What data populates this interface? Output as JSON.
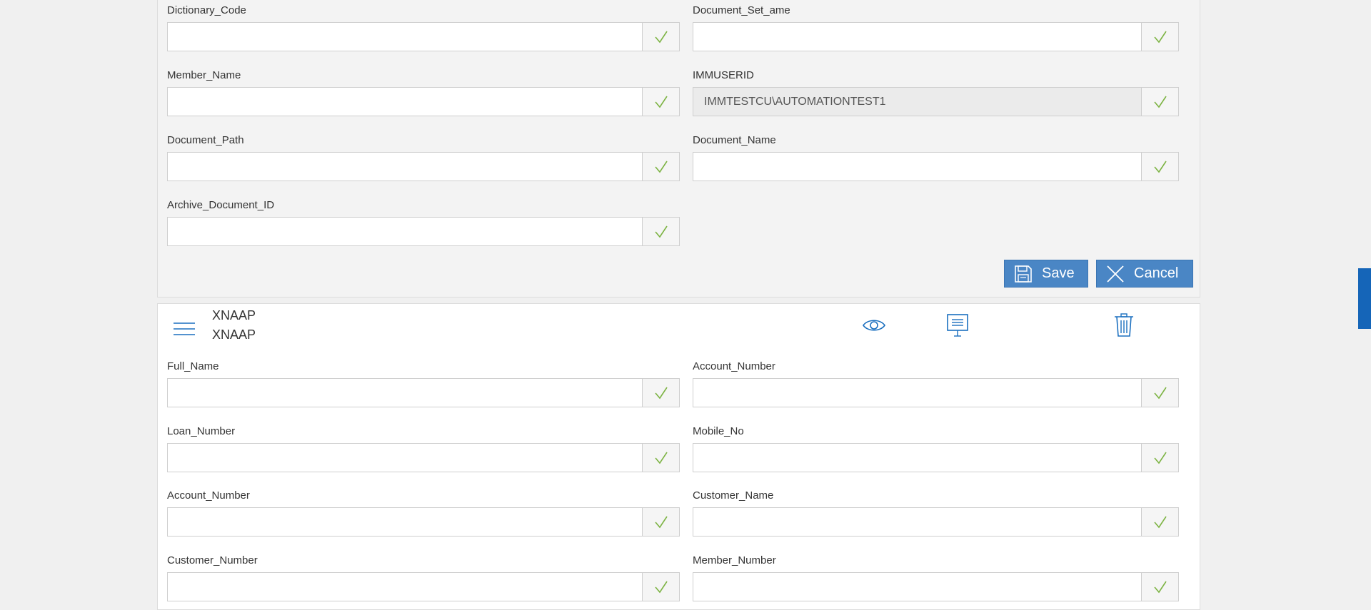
{
  "top_form": {
    "fields": [
      {
        "label": "Dictionary_Code",
        "value": ""
      },
      {
        "label": "Document_Set_ame",
        "value": ""
      },
      {
        "label": "Member_Name",
        "value": ""
      },
      {
        "label": "IMMUSERID",
        "value": "IMMTESTCU\\AUTOMATIONTEST1"
      },
      {
        "label": "Document_Path",
        "value": ""
      },
      {
        "label": "Document_Name",
        "value": ""
      },
      {
        "label": "Archive_Document_ID",
        "value": ""
      }
    ],
    "save_label": "Save",
    "cancel_label": "Cancel"
  },
  "card": {
    "title_line1": "XNAAP",
    "title_line2": "XNAAP",
    "fields": [
      {
        "label": "Full_Name",
        "value": ""
      },
      {
        "label": "Account_Number",
        "value": ""
      },
      {
        "label": "Loan_Number",
        "value": ""
      },
      {
        "label": "Mobile_No",
        "value": ""
      },
      {
        "label": "Account_Number",
        "value": ""
      },
      {
        "label": "Customer_Name",
        "value": ""
      },
      {
        "label": "Customer_Number",
        "value": ""
      },
      {
        "label": "Member_Number",
        "value": ""
      }
    ]
  },
  "icons": {
    "check": "check-icon",
    "save": "floppy-disk-icon",
    "cancel": "close-icon",
    "menu": "hamburger-menu-icon",
    "view": "eye-icon",
    "present": "presentation-icon",
    "delete": "trash-icon"
  },
  "colors": {
    "accent": "#4a86c5",
    "check": "#7cb342",
    "icon_blue": "#1a6fbf",
    "side_tab": "#1565b8"
  }
}
